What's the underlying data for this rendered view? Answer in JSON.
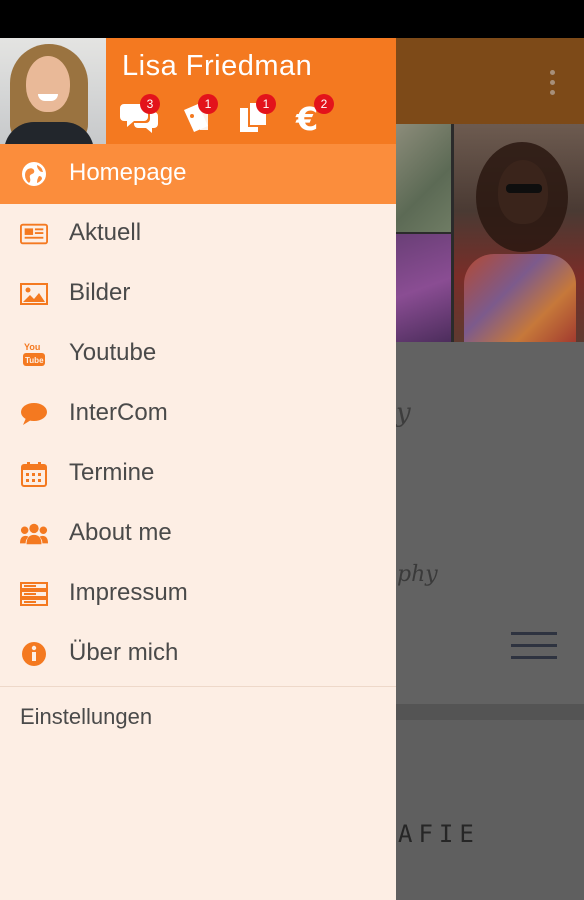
{
  "user": {
    "name": "Lisa Friedman"
  },
  "header_icons": [
    {
      "icon": "chat-bubbles-icon",
      "badge": "3"
    },
    {
      "icon": "tickets-icon",
      "badge": "1"
    },
    {
      "icon": "documents-icon",
      "badge": "1"
    },
    {
      "icon": "euro-icon",
      "badge": "2"
    }
  ],
  "menu": {
    "items": [
      {
        "label": "Homepage",
        "icon": "globe-icon",
        "active": true
      },
      {
        "label": "Aktuell",
        "icon": "newspaper-icon"
      },
      {
        "label": "Bilder",
        "icon": "picture-icon"
      },
      {
        "label": "Youtube",
        "icon": "youtube-icon"
      },
      {
        "label": "InterCom",
        "icon": "speech-bubble-icon"
      },
      {
        "label": "Termine",
        "icon": "calendar-icon"
      },
      {
        "label": "About me",
        "icon": "users-icon"
      },
      {
        "label": "Impressum",
        "icon": "server-icon"
      },
      {
        "label": "Über mich",
        "icon": "info-icon"
      }
    ],
    "settings_label": "Einstellungen"
  },
  "background": {
    "subtitle": "phy",
    "label": "AFIE"
  },
  "colors": {
    "accent": "#f47920",
    "active_item": "#fb8d3c",
    "drawer_bg": "#fdeee4",
    "badge": "#e3131b"
  }
}
